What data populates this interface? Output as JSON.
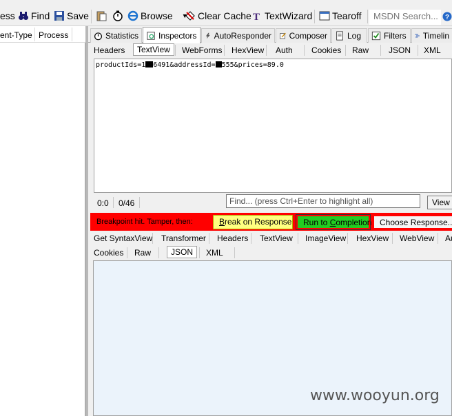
{
  "toolbar": {
    "items": [
      {
        "label": "ess",
        "icon": "none"
      },
      {
        "label": "Find",
        "icon": "binoculars-icon"
      },
      {
        "label": "Save",
        "icon": "save-icon"
      },
      {
        "label": "",
        "icon": "clipboard-icon"
      },
      {
        "label": "",
        "icon": "timer-icon"
      },
      {
        "label": "Browse",
        "icon": "ie-browser-icon"
      },
      {
        "label": "Clear Cache",
        "icon": "clear-cache-icon"
      },
      {
        "label": "TextWizard",
        "icon": "textwizard-icon"
      },
      {
        "label": "Tearoff",
        "icon": "tearoff-icon"
      }
    ],
    "search_placeholder": "MSDN Search...",
    "help_icon": "help-icon"
  },
  "session_list": {
    "columns": [
      "ent-Type",
      "Process"
    ]
  },
  "main_tabs": [
    {
      "label": "Statistics",
      "icon": "timer-icon",
      "active": false
    },
    {
      "label": "Inspectors",
      "icon": "inspectors-icon",
      "active": true
    },
    {
      "label": "AutoResponder",
      "icon": "lightning-icon",
      "active": false
    },
    {
      "label": "Composer",
      "icon": "composer-icon",
      "active": false
    },
    {
      "label": "Log",
      "icon": "log-icon",
      "active": false
    },
    {
      "label": "Filters",
      "icon": "checkbox-icon",
      "active": false
    },
    {
      "label": "Timelin",
      "icon": "timeline-icon",
      "active": false
    }
  ],
  "request_tabs": [
    "Headers",
    "TextView",
    "WebForms",
    "HexView",
    "Auth",
    "Cookies",
    "Raw",
    "JSON",
    "XML"
  ],
  "request_active_tab": "TextView",
  "request_body": {
    "part1": "productIds=1",
    "part2": "6491&addressId=",
    "part3": "555&prices=89.0"
  },
  "status": {
    "position": "0:0",
    "count": "0/46",
    "find_placeholder": "Find... (press Ctrl+Enter to highlight all)",
    "view_button": "View in"
  },
  "breakpoint": {
    "message": "Breakpoint hit. Tamper, then:",
    "break_button": "Break on Response",
    "run_button": "Run to Completion",
    "choose_button": "Choose Response..."
  },
  "response_tabs_row1": [
    "Get SyntaxView",
    "Transformer",
    "Headers",
    "TextView",
    "ImageView",
    "HexView",
    "WebView",
    "Au"
  ],
  "response_tabs_row2": [
    "Cookies",
    "Raw",
    "JSON",
    "XML"
  ],
  "response_active_tab": "JSON",
  "watermark": "www.wooyun.org",
  "colors": {
    "breakpoint_bar": "#ff0000",
    "break_button": "#ffff80",
    "run_button": "#22cc22",
    "response_area": "#ebf3fb"
  }
}
